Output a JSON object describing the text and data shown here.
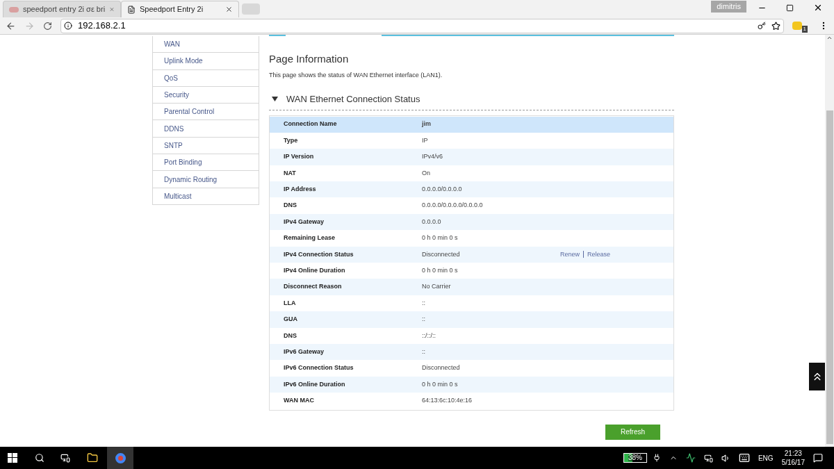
{
  "browser": {
    "tabs": [
      {
        "title": "speedport entry 2i σε bri",
        "selected": false
      },
      {
        "title": "Speedport Entry 2i",
        "selected": true
      }
    ],
    "profile": "dimitris",
    "address": "192.168.2.1",
    "extension_badge": "1"
  },
  "sidebar": {
    "items": [
      "WAN",
      "Uplink Mode",
      "QoS",
      "Security",
      "Parental Control",
      "DDNS",
      "SNTP",
      "Port Binding",
      "Dynamic Routing",
      "Multicast"
    ]
  },
  "page": {
    "title": "Page Information",
    "description": "This page shows the status of WAN Ethernet interface (LAN1).",
    "section": {
      "title": "WAN Ethernet Connection Status",
      "expanded": true
    },
    "rows": [
      {
        "label": "Connection Name",
        "value": "jim",
        "selected": true
      },
      {
        "label": "Type",
        "value": "IP",
        "selected": false
      },
      {
        "label": "IP Version",
        "value": "IPv4/v6",
        "selected": false
      },
      {
        "label": "NAT",
        "value": "On",
        "selected": false
      },
      {
        "label": "IP Address",
        "value": "0.0.0.0/0.0.0.0",
        "selected": false
      },
      {
        "label": "DNS",
        "value": "0.0.0.0/0.0.0.0/0.0.0.0",
        "selected": false
      },
      {
        "label": "IPv4 Gateway",
        "value": "0.0.0.0",
        "selected": false
      },
      {
        "label": "Remaining Lease",
        "value": "0 h 0 min 0 s",
        "selected": false
      },
      {
        "label": "IPv4 Connection Status",
        "value": "Disconnected",
        "selected": false,
        "actions": [
          "Renew",
          "Release"
        ]
      },
      {
        "label": "IPv4 Online Duration",
        "value": "0 h 0 min 0 s",
        "selected": false
      },
      {
        "label": "Disconnect Reason",
        "value": "No Carrier",
        "selected": false
      },
      {
        "label": "LLA",
        "value": "::",
        "selected": false
      },
      {
        "label": "GUA",
        "value": "::",
        "selected": false
      },
      {
        "label": "DNS",
        "value": "::/::/::",
        "selected": false
      },
      {
        "label": "IPv6 Gateway",
        "value": "::",
        "selected": false
      },
      {
        "label": "IPv6 Connection Status",
        "value": "Disconnected",
        "selected": false
      },
      {
        "label": "IPv6 Online Duration",
        "value": "0 h 0 min 0 s",
        "selected": false
      },
      {
        "label": "WAN MAC",
        "value": "64:13:6c:10:4e:16",
        "selected": false
      }
    ],
    "refresh_button": "Refresh"
  },
  "taskbar": {
    "battery": {
      "reading": "38%",
      "level": 0.38
    },
    "language": "ENG",
    "time": "21:23",
    "date": "5/16/17"
  }
}
